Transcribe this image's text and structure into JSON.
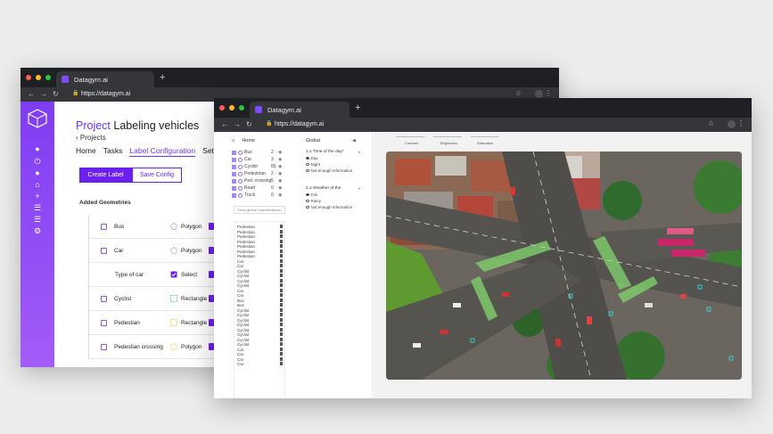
{
  "window1": {
    "tab_title": "Datagym.ai",
    "url": "https://datagym.ai",
    "project_prefix": "Project",
    "project_name": "Labeling vehicles",
    "back_label": "Projects",
    "nav_tabs": [
      "Home",
      "Tasks",
      "Label Configuration",
      "Settings"
    ],
    "active_tab": "Label Configuration",
    "create_label_button": "Create Label",
    "save_config_button": "Save Config",
    "added_geometries_heading": "Added Geometries",
    "geometries": [
      {
        "name": "Bus",
        "shape": "Polygon"
      },
      {
        "name": "Car",
        "shape": "Polygon"
      },
      {
        "name": "Type of car",
        "shape": "Select",
        "child": true
      },
      {
        "name": "Cyclist",
        "shape": "Rectangle"
      },
      {
        "name": "Pedestian",
        "shape": "Rectangle"
      },
      {
        "name": "Pedestian crossing",
        "shape": "Polygon"
      }
    ],
    "sidebar_icons": [
      "user-icon",
      "power-icon",
      "person-icon",
      "home-icon",
      "plus-icon",
      "list-icon",
      "checklist-icon",
      "gear-icon"
    ]
  },
  "window2": {
    "tab_title": "Datagym.ai",
    "url": "https://datagym.ai",
    "home_label": "Home",
    "classes": [
      {
        "name": "Bus",
        "count": "2"
      },
      {
        "name": "Car",
        "count": "3"
      },
      {
        "name": "Cyclist",
        "count": "85"
      },
      {
        "name": "Pedestrian",
        "count": "2"
      },
      {
        "name": "Ped. crossing",
        "count": "5"
      },
      {
        "name": "Road",
        "count": "0"
      },
      {
        "name": "Truck",
        "count": "0"
      }
    ],
    "show_global_label": "Show global Classifications",
    "objects": [
      "Pedestian",
      "Pedestian",
      "Pedestian",
      "Pedestian",
      "Pedestian",
      "Pedestian",
      "Pedestian",
      "Car",
      "Car",
      "Cyclist",
      "Cyclist",
      "Cyclist",
      "Cyclist",
      "Car",
      "Car",
      "Bus",
      "Bus",
      "Cyclist",
      "Cyclist",
      "Cyclist",
      "Cyclist",
      "Cyclist",
      "Cyclist",
      "Cyclist",
      "Cyclist",
      "Car",
      "Car",
      "Car",
      "Car"
    ],
    "global": {
      "title": "Global",
      "q1": "1.1 Time of the day*",
      "q1_options": [
        "Day",
        "Night",
        "Not enough information"
      ],
      "q1_selected": 0,
      "q2": "2.1 Weather of the",
      "q2_options": [
        "Fair",
        "Rainy",
        "Not enough information"
      ],
      "q2_selected": 0
    },
    "sliders": [
      "Contrast",
      "Brightness",
      "Saturation"
    ]
  }
}
